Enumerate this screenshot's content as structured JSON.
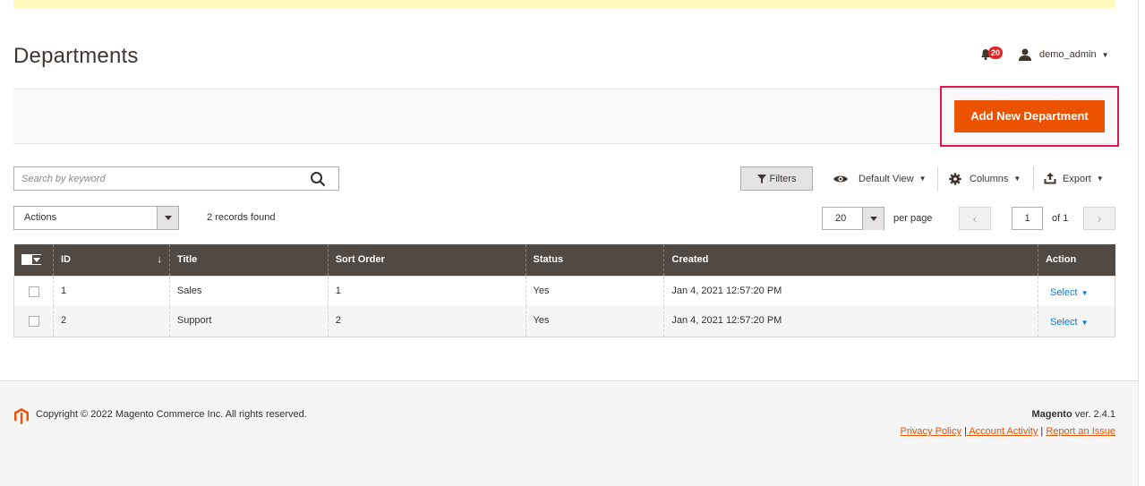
{
  "header": {
    "title": "Departments",
    "notifications_count": "20",
    "user_name": "demo_admin"
  },
  "action_bar": {
    "add_button_label": "Add New Department"
  },
  "toolbar": {
    "search_placeholder": "Search by keyword",
    "filters_label": "Filters",
    "view_label": "Default View",
    "columns_label": "Columns",
    "export_label": "Export",
    "actions_label": "Actions",
    "records_found": "2 records found",
    "per_page_value": "20",
    "per_page_label": "per page",
    "current_page": "1",
    "total_pages_label": "of 1"
  },
  "grid": {
    "columns": [
      "ID",
      "Title",
      "Sort Order",
      "Status",
      "Created",
      "Action"
    ],
    "rows": [
      {
        "id": "1",
        "title": "Sales",
        "sort_order": "1",
        "status": "Yes",
        "created": "Jan 4, 2021 12:57:20 PM",
        "action": "Select"
      },
      {
        "id": "2",
        "title": "Support",
        "sort_order": "2",
        "status": "Yes",
        "created": "Jan 4, 2021 12:57:20 PM",
        "action": "Select"
      }
    ]
  },
  "footer": {
    "copyright": "Copyright © 2022 Magento Commerce Inc. All rights reserved.",
    "brand": "Magento",
    "version": " ver. 2.4.1",
    "links": [
      "Privacy Policy",
      " Account Activity",
      "Report an Issue"
    ]
  },
  "colors": {
    "accent": "#eb5202",
    "grid_header": "#514943",
    "highlight": "#e3154c",
    "link": "#007bdb"
  },
  "icons": [
    "bell-icon",
    "user-icon",
    "search-icon",
    "filter-icon",
    "eye-icon",
    "gear-icon",
    "export-icon",
    "magento-logo-icon"
  ]
}
